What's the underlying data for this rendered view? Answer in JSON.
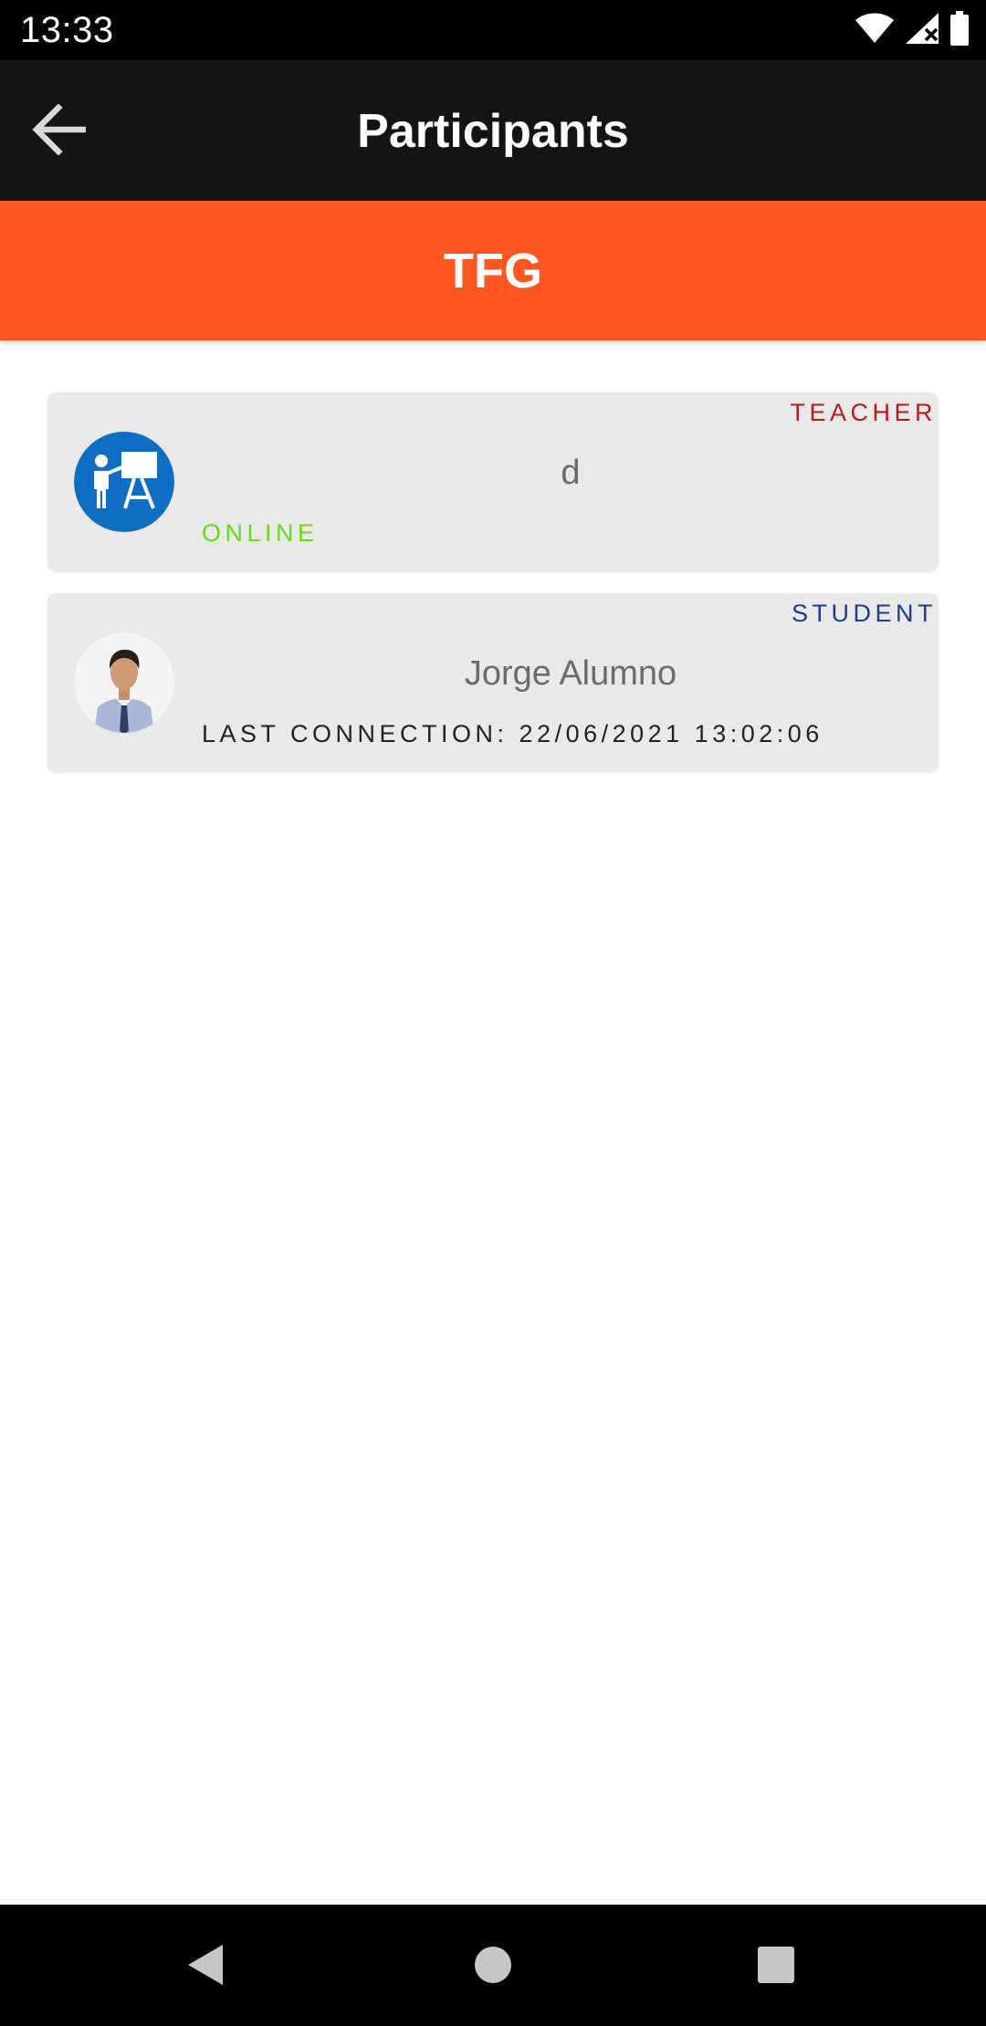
{
  "status_bar": {
    "time": "13:33",
    "icons": [
      "wifi-icon",
      "signal-icon",
      "battery-icon"
    ]
  },
  "toolbar": {
    "back_icon": "arrow-left-icon",
    "title": "Participants"
  },
  "course": {
    "title": "TFG",
    "color": "#ff5722"
  },
  "participants": [
    {
      "role": "TEACHER",
      "name": "d",
      "status": "ONLINE",
      "avatar": "teacher-board-icon",
      "role_color": "#b71c1c",
      "status_color": "#64dd17"
    },
    {
      "role": "STUDENT",
      "name": "Jorge Alumno",
      "status": "LAST CONNECTION: 22/06/2021 13:02:06",
      "avatar": "profile-photo",
      "role_color": "#1a3e8c",
      "status_color": "#222222"
    }
  ],
  "nav_bar": {
    "buttons": [
      "back-triangle-icon",
      "home-circle-icon",
      "recents-square-icon"
    ]
  }
}
